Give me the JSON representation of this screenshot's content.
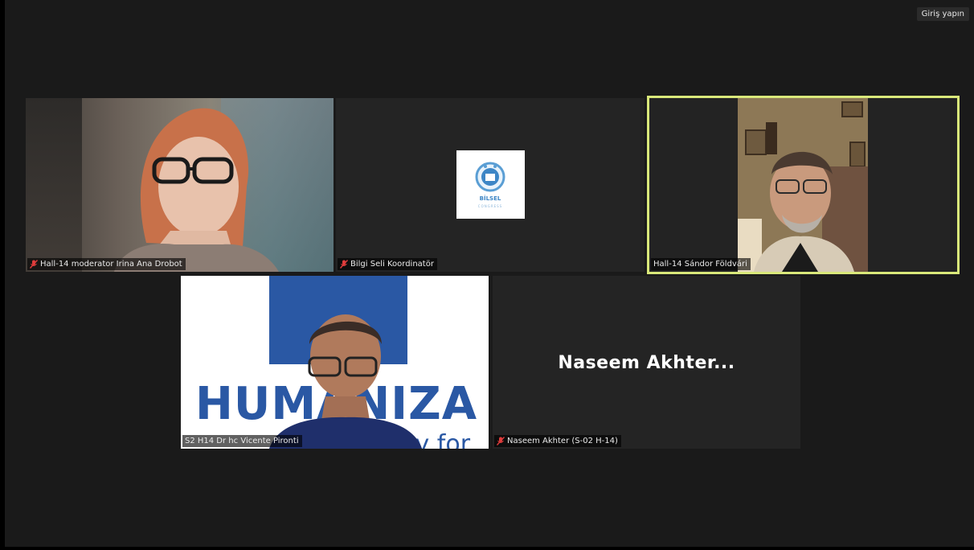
{
  "header": {
    "signin_label": "Giriş yapın"
  },
  "tiles": [
    {
      "name": "Hall-14 moderator Irina Ana Drobot",
      "muted": true
    },
    {
      "name": "Bilgi Seli Koordinatör",
      "muted": true,
      "logo_text": "BİLSEL",
      "logo_sub": "CONGRESS"
    },
    {
      "name": "Hall-14 Sándor Földvári",
      "muted": false,
      "active_speaker": true
    },
    {
      "name": "S2 H14 Dr hc Vicente Pironti",
      "muted": false,
      "banner_text": "HUMANIZA",
      "banner_sub": "cy for"
    },
    {
      "name": "Naseem Akhter (S-02 H-14)",
      "muted": true,
      "display_name": "Naseem  Akhter..."
    }
  ],
  "colors": {
    "active_border": "#d9e87a",
    "mute_red": "#e03c3c",
    "brand_blue": "#2a58a4"
  }
}
